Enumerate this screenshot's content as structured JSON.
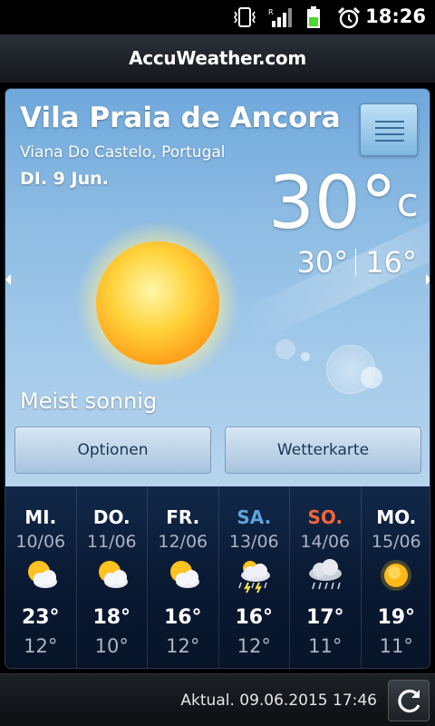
{
  "status_bar": {
    "time": "18:26"
  },
  "header": {
    "logo": "AccuWeather.com"
  },
  "location": {
    "city": "Vila Praia de Ancora",
    "region": "Viana Do Castelo, Portugal",
    "date": "DI. 9 Jun."
  },
  "current": {
    "temp": "30°",
    "unit": "c",
    "high": "30°",
    "low": "16°",
    "condition": "Meist sonnig",
    "icon": "sun-icon"
  },
  "buttons": {
    "options": "Optionen",
    "map": "Wetterkarte"
  },
  "colors": {
    "saturday": "#5ea3dc",
    "sunday": "#f2663a"
  },
  "forecast": [
    {
      "name": "MI.",
      "date": "10/06",
      "icon": "partly-sunny-icon",
      "high": "23°",
      "low": "12°"
    },
    {
      "name": "DO.",
      "date": "11/06",
      "icon": "partly-sunny-icon",
      "high": "18°",
      "low": "10°"
    },
    {
      "name": "FR.",
      "date": "12/06",
      "icon": "partly-sunny-icon",
      "high": "16°",
      "low": "12°"
    },
    {
      "name": "SA.",
      "date": "13/06",
      "icon": "thunderstorm-icon",
      "high": "16°",
      "low": "12°"
    },
    {
      "name": "SO.",
      "date": "14/06",
      "icon": "rain-icon",
      "high": "17°",
      "low": "11°"
    },
    {
      "name": "MO.",
      "date": "15/06",
      "icon": "sun-icon",
      "high": "19°",
      "low": "11°"
    }
  ],
  "footer": {
    "updated": "Aktual. 09.06.2015 17:46"
  }
}
